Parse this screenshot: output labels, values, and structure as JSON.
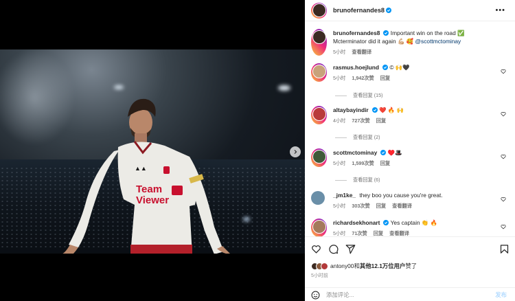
{
  "header": {
    "username": "brunofernandes8",
    "more_label": "•••"
  },
  "caption": {
    "username": "brunofernandes8",
    "text": "Important win on the road ✅ Mcterminator did it again 💪🏼 🥰",
    "mention": "@scottmctominay",
    "time": "5小时",
    "translate": "查看翻译"
  },
  "comments": [
    {
      "username": "rasmus.hoejlund",
      "verified": true,
      "text": "© 🙌🖤",
      "time": "5小时",
      "likes": "1,942次赞",
      "reply": "回复",
      "view_replies": "查看回复 (15)",
      "avatar_color": "#c8a27a"
    },
    {
      "username": "altaybayindir",
      "verified": true,
      "text": "❤️ 🔥 🙌",
      "time": "4小时",
      "likes": "727次赞",
      "reply": "回复",
      "view_replies": "查看回复 (2)",
      "avatar_color": "#b93a3a"
    },
    {
      "username": "scottmctominay",
      "verified": true,
      "text": "♥️🎩",
      "time": "5小时",
      "likes": "1,599次赞",
      "reply": "回复",
      "view_replies": "查看回复 (6)",
      "avatar_color": "#3f5a3a"
    },
    {
      "username": "_jm1ke_",
      "verified": false,
      "text": "they boo you cause you're great.",
      "time": "5小时",
      "likes": "303次赞",
      "reply": "回复",
      "translate": "查看翻译",
      "avatar_color": "#6a8fa8"
    },
    {
      "username": "richardsekhonart",
      "verified": true,
      "text": "Yes captain 👏 🔥",
      "time": "5小时",
      "likes": "71次赞",
      "reply": "回复",
      "translate": "查看翻译",
      "avatar_color": "#a47a5c"
    }
  ],
  "likes_bar": {
    "text_prefix": "antony00和",
    "text_bold": "其他12.1万位用户",
    "text_suffix": "赞了",
    "time": "5小时前"
  },
  "add_comment": {
    "placeholder": "添加评论...",
    "post_label": "发布"
  },
  "colors": {
    "verified": "#0095f6",
    "mention": "#00376b",
    "meta": "#737373"
  }
}
